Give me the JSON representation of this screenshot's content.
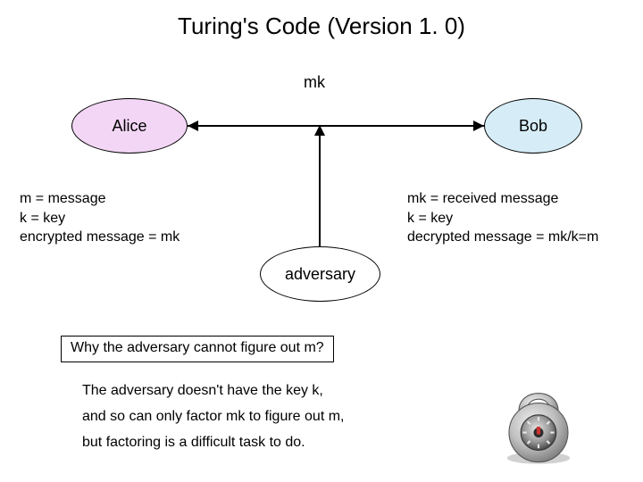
{
  "title": "Turing's Code (Version 1. 0)",
  "nodes": {
    "alice": "Alice",
    "bob": "Bob",
    "adversary": "adversary"
  },
  "channel_label": "mk",
  "alice_note": {
    "l1": "m = message",
    "l2": "k = key",
    "l3": "encrypted message = mk"
  },
  "bob_note": {
    "l1": "mk = received message",
    "l2": "k = key",
    "l3": "decrypted message = mk/k=m"
  },
  "question": "Why the adversary cannot figure out m?",
  "explain": {
    "l1": "The adversary doesn't have the key k,",
    "l2": "and so can only factor mk to figure out m,",
    "l3": "but factoring is a difficult task to do."
  },
  "icon": "padlock"
}
